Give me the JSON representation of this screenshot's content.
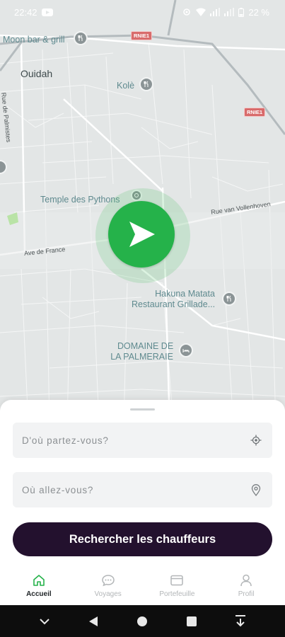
{
  "status_bar": {
    "time": "22:42",
    "battery": "22 %",
    "icons": [
      "youtube-icon",
      "cast-icon",
      "wifi-icon",
      "signal-icon",
      "signal-icon",
      "battery-icon"
    ]
  },
  "map": {
    "places": {
      "moon_bar": "Moon bar & grill",
      "ouidah": "Ouidah",
      "kole": "Kolè",
      "temple": "Temple des Pythons",
      "hakuna_line1": "Hakuna Matata",
      "hakuna_line2": "Restaurant Grillade...",
      "domaine_line1": "DOMAINE DE",
      "domaine_line2": "LA PALMERAIE"
    },
    "streets": {
      "rue_palmistes": "Rue de Palmistes",
      "rue_vollenhoven": "Rue van Vollenhoven",
      "ave_france": "Ave de France"
    },
    "route_badges": [
      "RNIE1",
      "RNIE1"
    ],
    "colors": {
      "land": "#e3e6e6",
      "road": "#ffffff",
      "highway": "#a9b0b3",
      "pin": "#25b24a"
    }
  },
  "sheet": {
    "departure_placeholder": "D'où partez-vous?",
    "destination_placeholder": "Où allez-vous?",
    "search_button": "Rechercher les chauffeurs",
    "button_color": "#23112e"
  },
  "tabs": [
    {
      "label": "Accueil",
      "icon": "home-icon",
      "active": true
    },
    {
      "label": "Voyages",
      "icon": "chat-bubble-icon",
      "active": false
    },
    {
      "label": "Portefeuille",
      "icon": "wallet-icon",
      "active": false
    },
    {
      "label": "Profil",
      "icon": "person-icon",
      "active": false
    }
  ],
  "nav_bar": [
    "chevron-down-icon",
    "back-icon",
    "home-circle-icon",
    "recents-icon",
    "download-icon"
  ]
}
